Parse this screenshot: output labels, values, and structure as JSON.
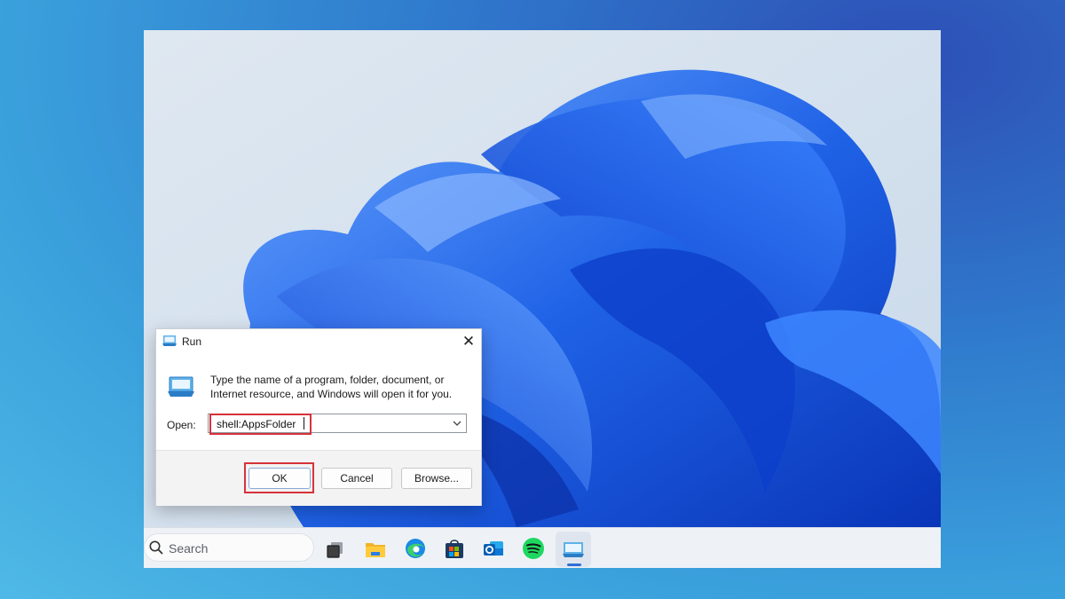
{
  "run_dialog": {
    "title": "Run",
    "description": "Type the name of a program, folder, document, or Internet resource, and Windows will open it for you.",
    "open_label": "Open:",
    "input_value": "shell:AppsFolder",
    "ok_label": "OK",
    "cancel_label": "Cancel",
    "browse_label": "Browse...",
    "highlight_color": "#d6323a"
  },
  "taskbar": {
    "search_placeholder": "Search",
    "icons": [
      "task-view-icon",
      "file-explorer-icon",
      "edge-icon",
      "microsoft-store-icon",
      "outlook-icon",
      "spotify-icon",
      "run-icon"
    ],
    "active_app": "run-icon"
  },
  "colors": {
    "wallpaper_blue": "#1f62e6",
    "accent": "#2f6fd6"
  }
}
